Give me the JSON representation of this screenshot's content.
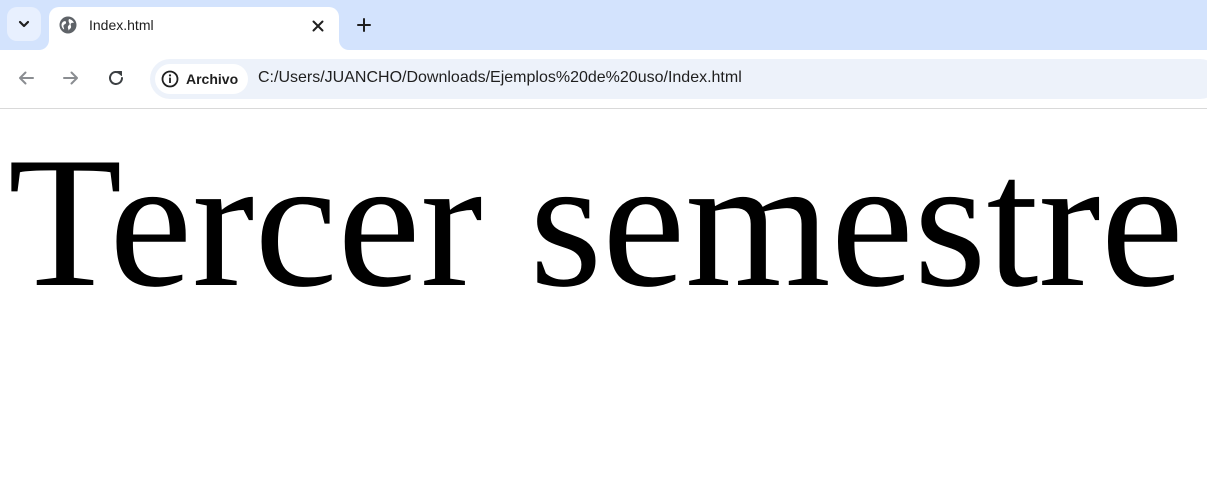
{
  "browser": {
    "tab": {
      "title": "Index.html"
    },
    "address_bar": {
      "site_chip_label": "Archivo",
      "url": "C:/Users/JUANCHO/Downloads/Ejemplos%20de%20uso/Index.html"
    },
    "icons": {
      "tab_search": "chevron-down-icon",
      "favicon": "globe-icon",
      "tab_close": "close-icon",
      "new_tab": "plus-icon",
      "back": "arrow-left-icon",
      "forward": "arrow-right-icon",
      "reload": "reload-icon",
      "site_info": "info-icon"
    },
    "colors": {
      "tabstrip": "#d3e3fd",
      "omnibox": "#edf2fa"
    }
  },
  "page": {
    "heading": "Tercer semestre"
  }
}
